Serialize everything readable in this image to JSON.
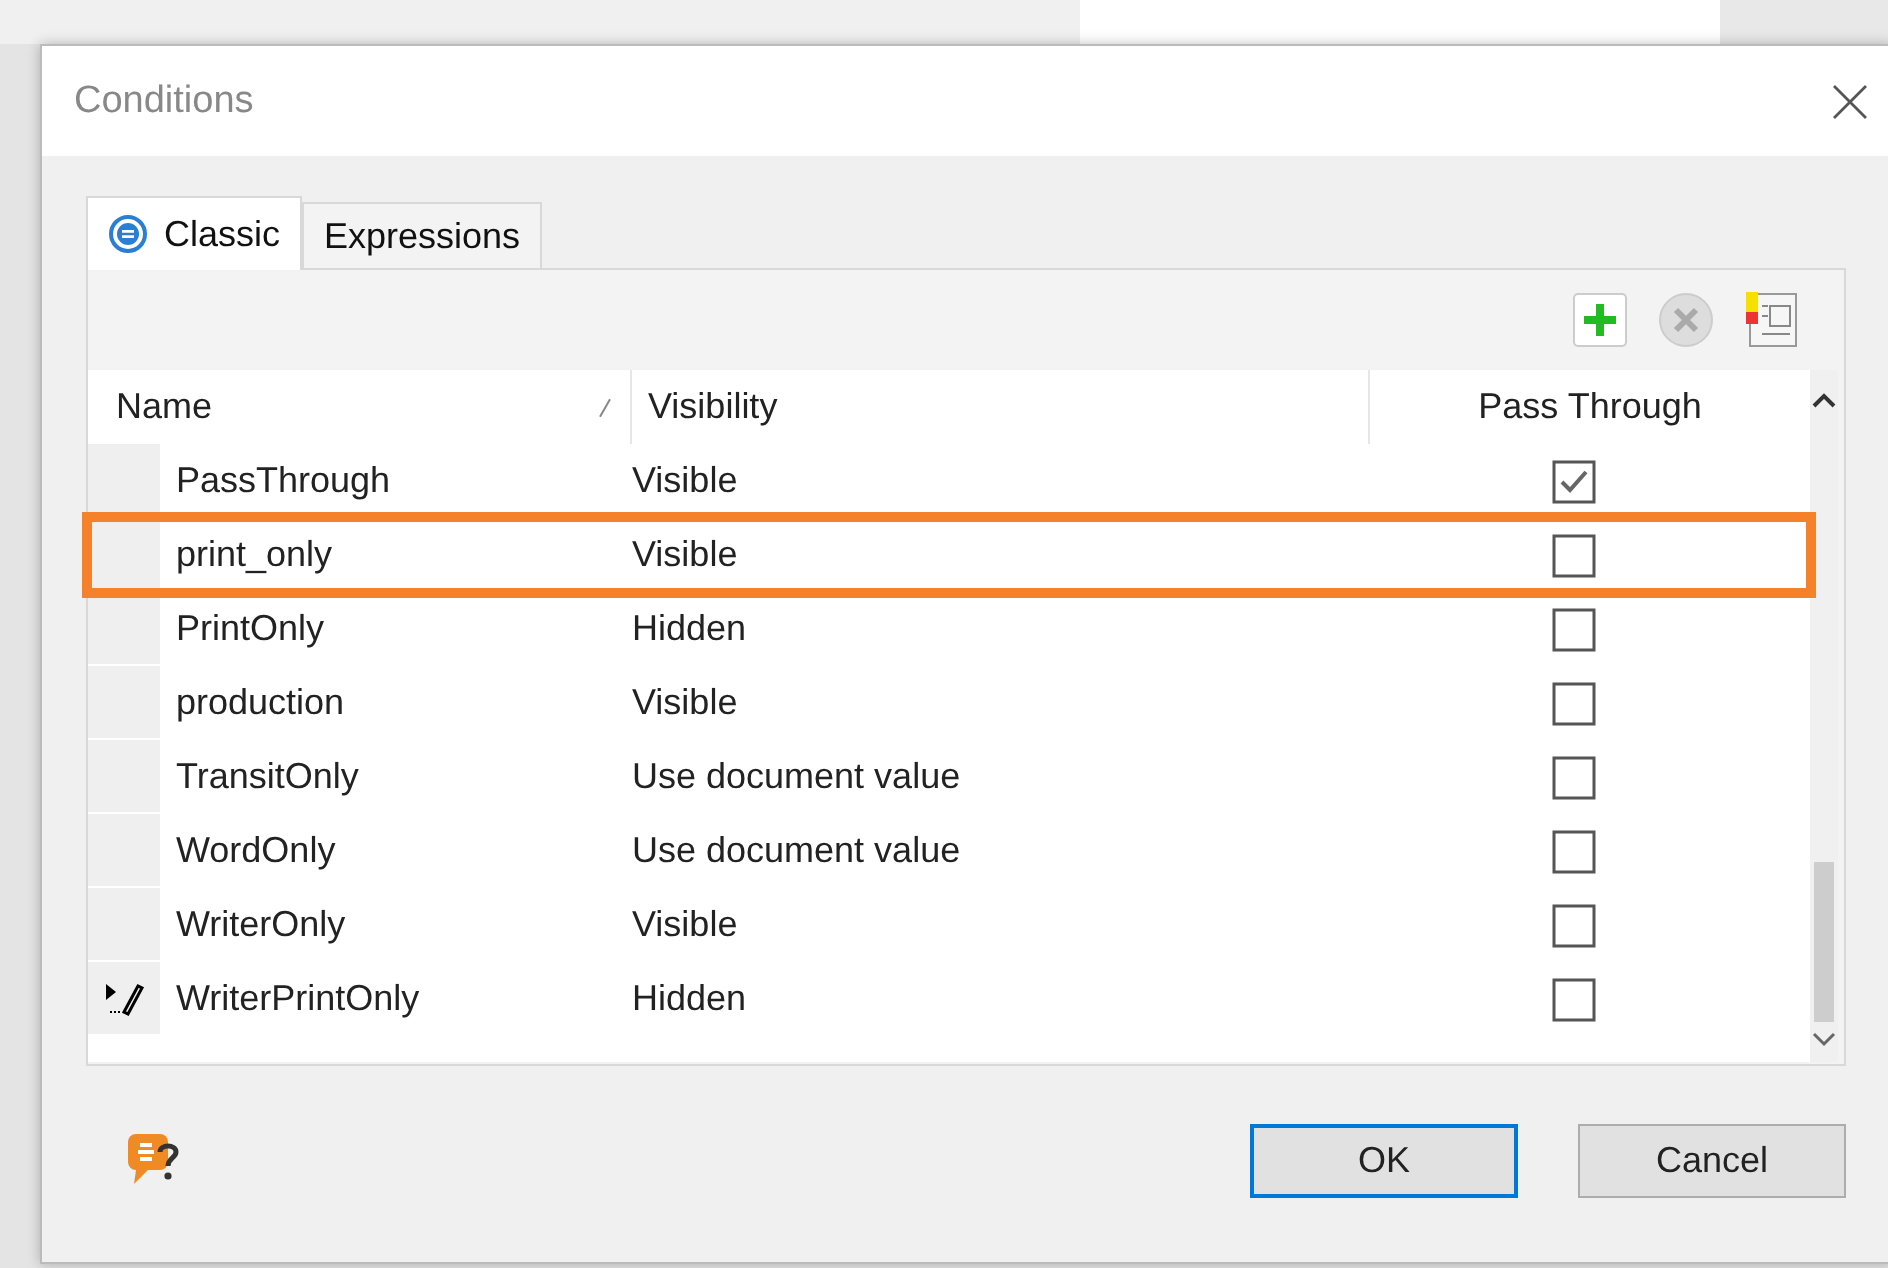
{
  "window": {
    "title": "Conditions"
  },
  "tabs": [
    {
      "label": "Classic",
      "selected": true,
      "icon": true
    },
    {
      "label": "Expressions",
      "selected": false,
      "icon": false
    }
  ],
  "table": {
    "columns": [
      "Name",
      "Visibility",
      "Pass Through"
    ],
    "rows": [
      {
        "name": "PassThrough",
        "visibility": "Visible",
        "checked": true,
        "highlighted": false,
        "editing": false
      },
      {
        "name": "print_only",
        "visibility": "Visible",
        "checked": false,
        "highlighted": true,
        "editing": false
      },
      {
        "name": "PrintOnly",
        "visibility": "Hidden",
        "checked": false,
        "highlighted": false,
        "editing": false
      },
      {
        "name": "production",
        "visibility": "Visible",
        "checked": false,
        "highlighted": false,
        "editing": false
      },
      {
        "name": "TransitOnly",
        "visibility": "Use document value",
        "checked": false,
        "highlighted": false,
        "editing": false
      },
      {
        "name": "WordOnly",
        "visibility": "Use document value",
        "checked": false,
        "highlighted": false,
        "editing": false
      },
      {
        "name": "WriterOnly",
        "visibility": "Visible",
        "checked": false,
        "highlighted": false,
        "editing": false
      },
      {
        "name": "WriterPrintOnly",
        "visibility": "Hidden",
        "checked": false,
        "highlighted": false,
        "editing": true
      }
    ]
  },
  "buttons": [
    {
      "label": "OK",
      "default": true
    },
    {
      "label": "Cancel",
      "default": false
    }
  ]
}
